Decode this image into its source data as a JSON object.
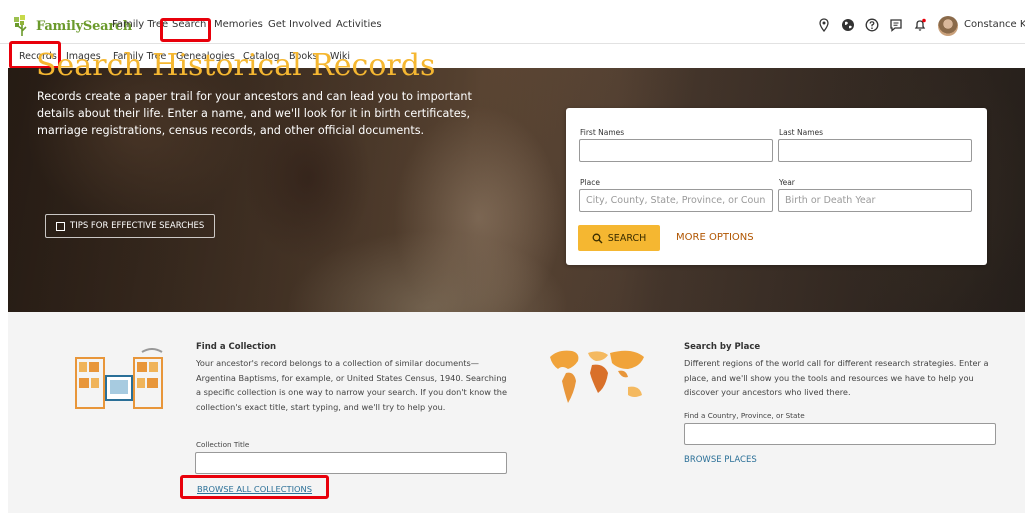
{
  "topnav": {
    "logo_text": "FamilySearch",
    "items": [
      "Family Tree",
      "Search",
      "Memories",
      "Get Involved",
      "Activities"
    ],
    "user_name": "Constance Kno",
    "icons": [
      "location-pin-icon",
      "globe-icon",
      "help-icon",
      "messages-icon",
      "notifications-icon"
    ]
  },
  "subnav": {
    "items": [
      "Records",
      "Images",
      "Family Tree",
      "Genealogies",
      "Catalog",
      "Books",
      "Wiki"
    ],
    "active": "Records"
  },
  "hero": {
    "title": "Search Historical Records",
    "description": "Records create a paper trail for your ancestors and can lead you to important details about their life. Enter a name, and we'll look for it in birth certificates, marriage registrations, census records, and other official documents.",
    "tips_label": "TIPS FOR EFFECTIVE SEARCHES"
  },
  "search_form": {
    "first_names_label": "First Names",
    "first_names_value": "",
    "last_names_label": "Last Names",
    "last_names_value": "",
    "place_label": "Place",
    "place_placeholder": "City, County, State, Province, or Coun",
    "year_label": "Year",
    "year_placeholder": "Birth or Death Year",
    "search_label": "SEARCH",
    "more_options_label": "MORE OPTIONS"
  },
  "find_collection": {
    "title": "Find a Collection",
    "body": "Your ancestor's record belongs to a collection of similar documents—Argentina Baptisms, for example, or United States Census, 1940. Searching a specific collection is one way to narrow your search. If you don't know the collection's exact title, start typing, and we'll try to help you.",
    "input_label": "Collection Title",
    "input_value": "",
    "browse_label": "BROWSE ALL COLLECTIONS"
  },
  "search_by_place": {
    "title": "Search by Place",
    "body": "Different regions of the world call for different research strategies. Enter a place, and we'll show you the tools and resources we have to help you discover your ancestors who lived there.",
    "input_label": "Find a Country, Province, or State",
    "input_value": "",
    "browse_label": "BROWSE PLACES"
  },
  "colors": {
    "brand_green": "#6b9a2c",
    "accent_gold": "#f5b731",
    "link_blue": "#2a6f97",
    "highlight_red": "#e8000b",
    "more_options_orange": "#b05500"
  }
}
